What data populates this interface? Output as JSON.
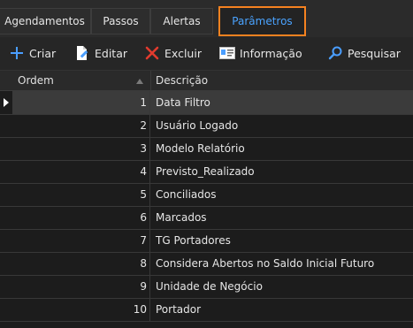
{
  "tabs": [
    {
      "label": "Agendamentos"
    },
    {
      "label": "Passos"
    },
    {
      "label": "Alertas"
    },
    {
      "label": "Parâmetros",
      "active": true
    }
  ],
  "toolbar": {
    "criar": "Criar",
    "editar": "Editar",
    "excluir": "Excluir",
    "informacao": "Informação",
    "pesquisar": "Pesquisar"
  },
  "grid": {
    "columns": [
      "Ordem",
      "Descrição"
    ],
    "sort_column": "Ordem",
    "sort_direction": "ascending",
    "rows": [
      {
        "ordem": "1",
        "descricao": "Data Filtro",
        "selected": true
      },
      {
        "ordem": "2",
        "descricao": "Usuário Logado"
      },
      {
        "ordem": "3",
        "descricao": "Modelo Relatório"
      },
      {
        "ordem": "4",
        "descricao": "Previsto_Realizado"
      },
      {
        "ordem": "5",
        "descricao": "Conciliados"
      },
      {
        "ordem": "6",
        "descricao": "Marcados"
      },
      {
        "ordem": "7",
        "descricao": "TG Portadores"
      },
      {
        "ordem": "8",
        "descricao": "Considera Abertos no Saldo Inicial Futuro"
      },
      {
        "ordem": "9",
        "descricao": "Unidade de Negócio"
      },
      {
        "ordem": "10",
        "descricao": "Portador"
      }
    ]
  },
  "colors": {
    "active_tab_border": "#f58220",
    "active_tab_text": "#4aa3ff",
    "plus_icon": "#4a9eff",
    "delete_icon": "#e23b2e"
  }
}
